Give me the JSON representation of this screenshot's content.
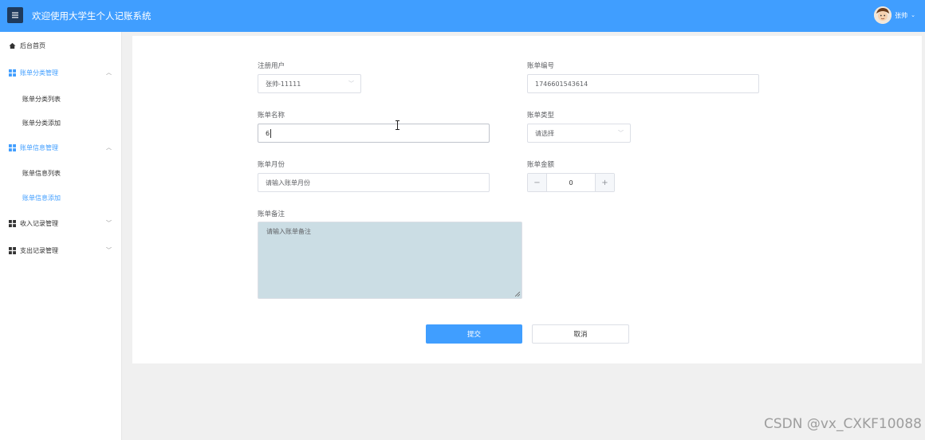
{
  "header": {
    "title": "欢迎使用大学生个人记账系统",
    "user_name": "张帅"
  },
  "sidebar": {
    "home": "后台首页",
    "groups": [
      {
        "label": "账单分类管理",
        "items": [
          "账单分类列表",
          "账单分类添加"
        ]
      },
      {
        "label": "账单信息管理",
        "items": [
          "账单信息列表",
          "账单信息添加"
        ]
      },
      {
        "label": "收入记录管理"
      },
      {
        "label": "支出记录管理"
      }
    ]
  },
  "form": {
    "user": {
      "label": "注册用户",
      "value": "张帅-11111"
    },
    "bill_no": {
      "label": "账单编号",
      "value": "1746601543614"
    },
    "bill_name": {
      "label": "账单名称",
      "value": "6"
    },
    "bill_type": {
      "label": "账单类型",
      "placeholder": "请选择"
    },
    "bill_month": {
      "label": "账单月份",
      "placeholder": "请输入账单月份"
    },
    "bill_amount": {
      "label": "账单金额",
      "value": "0",
      "minus": "−",
      "plus": "+"
    },
    "bill_note": {
      "label": "账单备注",
      "placeholder": "请输入账单备注"
    },
    "submit": "提交",
    "cancel": "取消"
  },
  "watermark": "CSDN @vx_CXKF10088",
  "colors": {
    "primary": "#409eff",
    "header_bg": "#409eff",
    "menu_btn": "#1f3a5c",
    "textarea_bg": "#cbdde4"
  }
}
